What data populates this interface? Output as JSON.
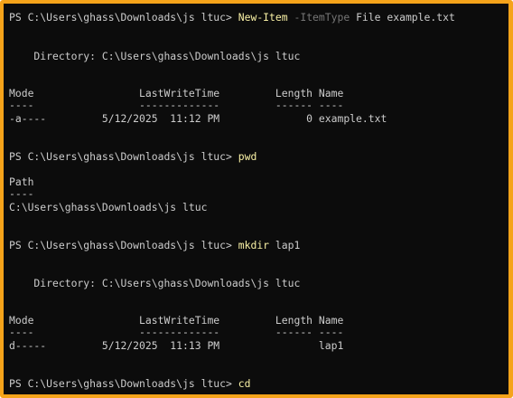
{
  "colors": {
    "frame": "#f5a31a",
    "background": "#0c0c0c",
    "text": "#cccccc",
    "command": "#f9f1a5",
    "parameter": "#767676"
  },
  "session": {
    "prompt": "PS C:\\Users\\ghass\\Downloads\\js ltuc> ",
    "block1": {
      "command": "New-Item",
      "param": "-ItemType",
      "args": "File example.txt",
      "directory_line": "    Directory: C:\\Users\\ghass\\Downloads\\js ltuc",
      "header": "Mode                 LastWriteTime         Length Name",
      "underline": "----                 -------------         ------ ----",
      "row": "-a----         5/12/2025  11:12 PM              0 example.txt"
    },
    "block2": {
      "command": "pwd",
      "header": "Path",
      "underline": "----",
      "value": "C:\\Users\\ghass\\Downloads\\js ltuc"
    },
    "block3": {
      "command": "mkdir",
      "args": "lap1",
      "directory_line": "    Directory: C:\\Users\\ghass\\Downloads\\js ltuc",
      "header": "Mode                 LastWriteTime         Length Name",
      "underline": "----                 -------------         ------ ----",
      "row": "d-----         5/12/2025  11:13 PM                lap1"
    },
    "block4": {
      "command": "cd"
    }
  }
}
